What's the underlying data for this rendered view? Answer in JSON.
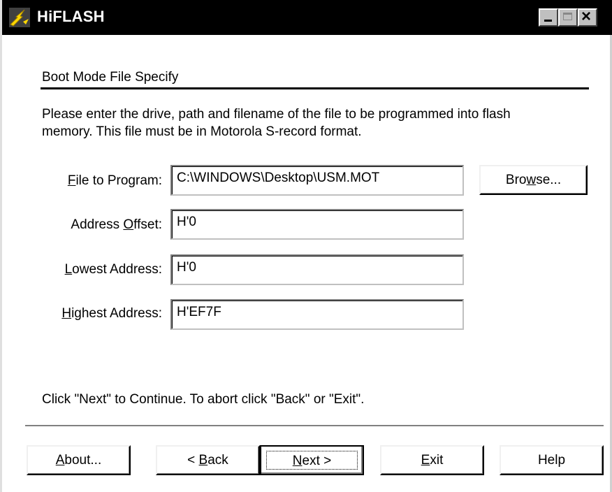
{
  "window": {
    "title": "HiFLASH",
    "icon": "flash-lightning-icon",
    "controls": {
      "minimize": "minimize-icon",
      "maximize": "maximize-icon",
      "close": "close-icon"
    }
  },
  "section": {
    "title": "Boot Mode File Specify",
    "description_line1": "Please enter the drive, path and filename of the file to be programmed into flash",
    "description_line2": "memory. This file must be in Motorola S-record format."
  },
  "fields": [
    {
      "label_pre": "",
      "label_key": "F",
      "label_post": "ile to Program:",
      "value": "C:\\WINDOWS\\Desktop\\USM.MOT"
    },
    {
      "label_pre": "Address ",
      "label_key": "O",
      "label_post": "ffset:",
      "value": "H'0"
    },
    {
      "label_pre": "",
      "label_key": "L",
      "label_post": "owest Address:",
      "value": "H'0"
    },
    {
      "label_pre": "",
      "label_key": "H",
      "label_post": "ighest Address:",
      "value": "H'EF7F"
    }
  ],
  "browse_button": {
    "pre": "Bro",
    "key": "w",
    "post": "se..."
  },
  "footer": {
    "instruction": "Click \"Next\" to Continue. To abort click \"Back\" or \"Exit\"."
  },
  "buttons": {
    "about": {
      "pre": "",
      "key": "A",
      "post": "bout..."
    },
    "back": {
      "pre": "< ",
      "key": "B",
      "post": "ack"
    },
    "next": {
      "pre": "",
      "key": "N",
      "post": "ext >"
    },
    "exit": {
      "pre": "",
      "key": "E",
      "post": "xit"
    },
    "help": {
      "label": "Help"
    }
  }
}
